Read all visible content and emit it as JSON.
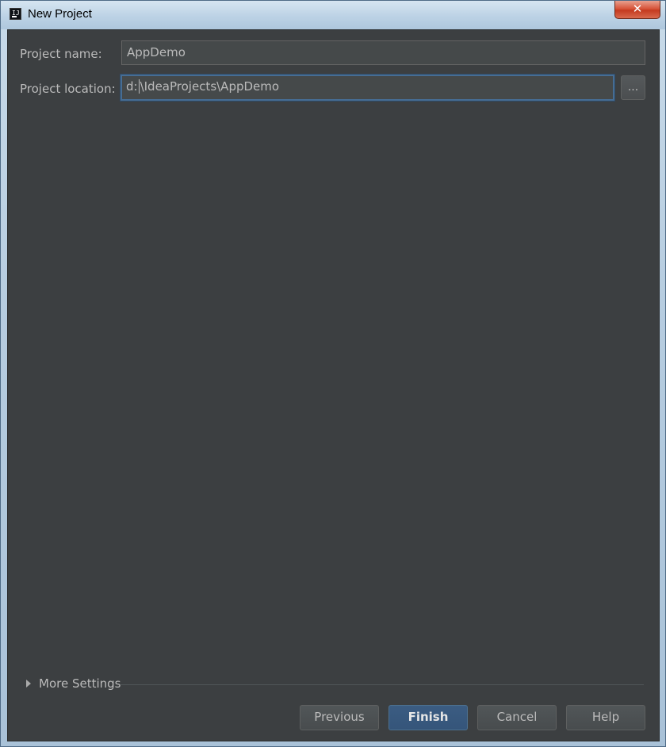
{
  "window": {
    "title": "New Project",
    "app_icon_text": "IJ",
    "close_glyph": "✕"
  },
  "form": {
    "project_name_label": "Project name:",
    "project_name_value": "AppDemo",
    "project_location_label": "Project location:",
    "project_location_value_before_caret": "d:",
    "project_location_value_after_caret": "\\IdeaProjects\\AppDemo",
    "browse_label": "..."
  },
  "more_settings": {
    "label": "More Settings",
    "expanded": false
  },
  "buttons": {
    "previous": "Previous",
    "finish": "Finish",
    "cancel": "Cancel",
    "help": "Help"
  },
  "colors": {
    "panel_bg": "#3c3f41",
    "text": "#bbbbbb",
    "focus_border": "#466d94",
    "default_button": "#365880"
  }
}
